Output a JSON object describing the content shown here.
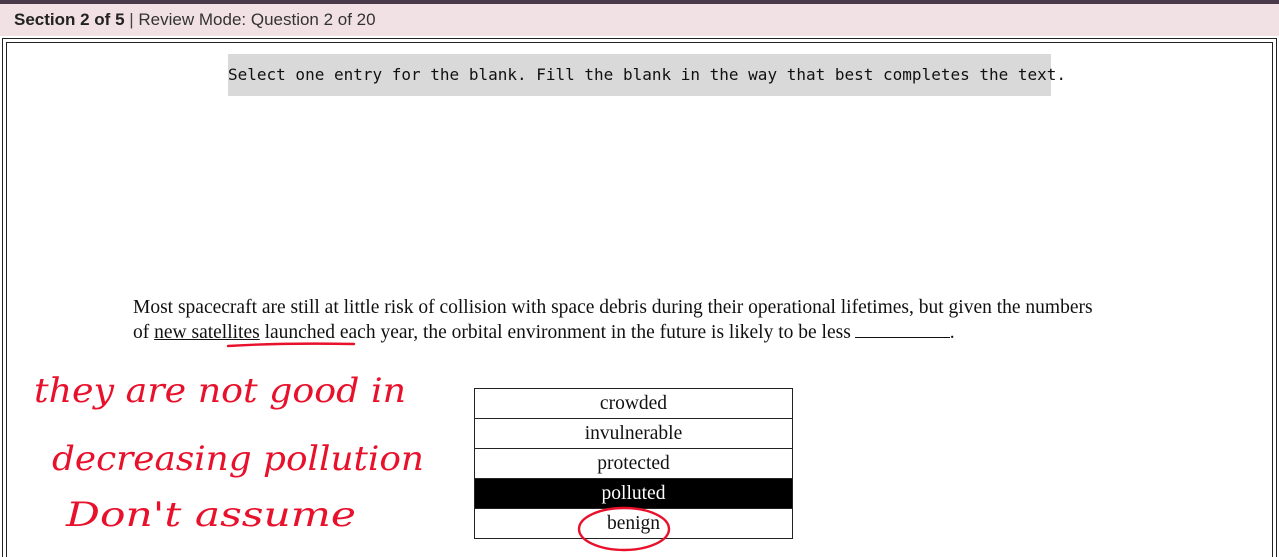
{
  "header": {
    "section_label": "Section 2 of 5",
    "separator": " | ",
    "mode_label": "Review Mode: Question 2 of 20"
  },
  "instruction": "Select one entry for the blank. Fill the blank in the way that best completes the text.",
  "passage": {
    "part1": "Most spacecraft are still at little risk of collision with space debris during their operational lifetimes, but given the numbers of ",
    "underlined": "new satellites",
    "part2": " launched each year, the orbital environment in the future is likely to be less",
    "end": "."
  },
  "choices": [
    {
      "label": "crowded",
      "selected": false
    },
    {
      "label": "invulnerable",
      "selected": false
    },
    {
      "label": "protected",
      "selected": false
    },
    {
      "label": "polluted",
      "selected": true
    },
    {
      "label": "benign",
      "selected": false
    }
  ],
  "handwriting": {
    "color": "#e8102a",
    "line1": "they are not good in",
    "line2": "decreasing pollution",
    "line3": "Don't assume"
  }
}
